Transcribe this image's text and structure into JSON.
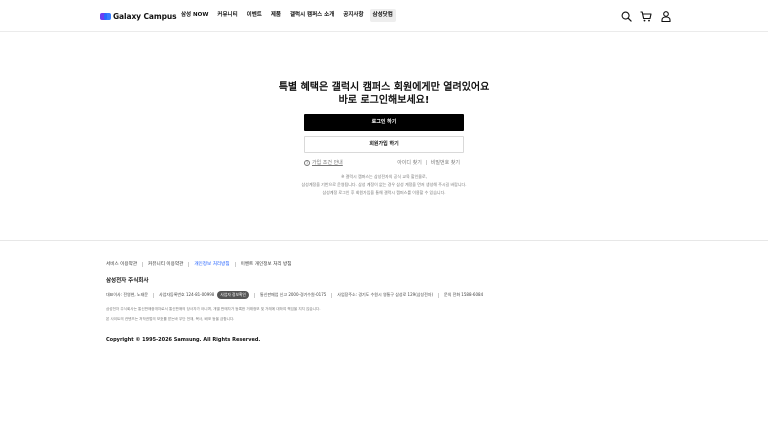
{
  "header": {
    "logo_text": "Galaxy Campus",
    "nav": [
      "삼성 NOW",
      "커뮤니티",
      "이벤트",
      "제품",
      "갤럭시 캠퍼스 소개",
      "공지사항",
      "삼성닷컴"
    ],
    "active_nav": "삼성닷컴",
    "icons": [
      "search-icon",
      "cart-icon",
      "user-icon"
    ]
  },
  "main": {
    "headline_line1": "특별 혜택은 갤럭시 캠퍼스 회원에게만 열려있어요",
    "headline_line2": "바로 로그인해보세요!",
    "login_button": "로그인 하기",
    "join_button": "회원가입 하기",
    "terms_link": "가입 조건 안내",
    "find_id": "아이디 찾기",
    "find_password": "비밀번호 찾기",
    "notice_lines": [
      "※ 갤럭시 캠퍼스는 삼성전자의 공식 교육 할인몰로,",
      "삼성계정을 기반으로 운영됩니다. 삼성 계정이 없는 경우 삼성 계정을 먼저 생성해 주시길 바랍니다.",
      "삼성계정 로그인 후 회원가입을 통해 갤럭시 캠퍼스를 이용할 수 있습니다."
    ]
  },
  "footer": {
    "links": [
      "서비스 이용약관",
      "커뮤니티 이용약관",
      "개인정보 처리방침",
      "이벤트 개인정보 처리 방침"
    ],
    "highlight_link": "개인정보 처리방침",
    "company": "삼성전자 주식회사",
    "info": {
      "ceo": "대표이사: 전영현, 노태문",
      "business_no": "사업자등록번호 124-81-00998",
      "business_badge": "사업자 정보확인",
      "mail_order": "통신판매업 신고 2000-경기수원-0175",
      "address": "사업장주소: 경기도 수원시 영통구 삼성로 129(삼성전자)",
      "phone": "문의 전화 1588-6084"
    },
    "legal_lines": [
      "삼성전자 주식회사는 통신판매중개자로서 통신판매의 당사자가 아니며, 개별 판매자가 등록한 거래정보 및 거래에 대하여 책임을 지지 않습니다.",
      "본 사이트의 컨텐츠는 저작권법의 보호를 받는바 무단 전재, 복사, 배포 등을 금합니다."
    ],
    "copyright": "Copyright © 1995-2026 Samsung. All Rights Reserved."
  },
  "colors": {
    "accent": "#1a5cff",
    "button": "#000000",
    "logo_purple": "#6b3ff2",
    "logo_blue": "#1f6fff"
  }
}
